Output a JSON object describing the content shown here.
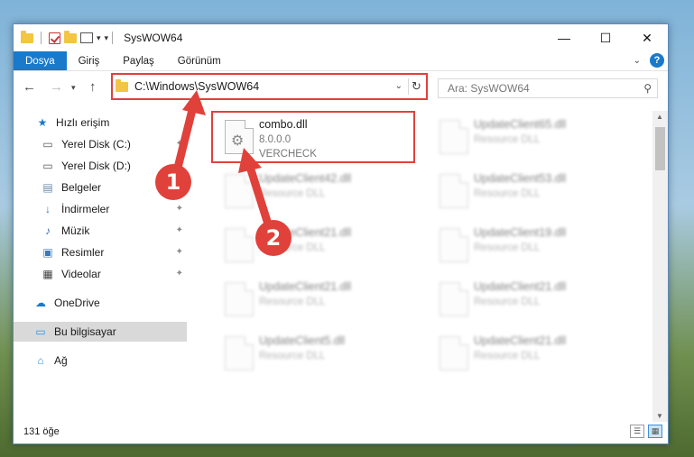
{
  "window": {
    "title": "SysWOW64",
    "controls": {
      "minimize": "—",
      "maximize": "☐",
      "close": "✕"
    }
  },
  "ribbon": {
    "tabs": [
      "Dosya",
      "Giriş",
      "Paylaş",
      "Görünüm"
    ],
    "help": "?"
  },
  "address": {
    "path": "C:\\Windows\\SysWOW64"
  },
  "search": {
    "placeholder": "Ara: SysWOW64"
  },
  "sidebar": {
    "items": [
      {
        "label": "Hızlı erişim",
        "icon": "star-icon"
      },
      {
        "label": "Yerel Disk (C:)",
        "icon": "drive-icon"
      },
      {
        "label": "Yerel Disk (D:)",
        "icon": "drive-icon"
      },
      {
        "label": "Belgeler",
        "icon": "documents-icon"
      },
      {
        "label": "İndirmeler",
        "icon": "download-icon"
      },
      {
        "label": "Müzik",
        "icon": "music-icon"
      },
      {
        "label": "Resimler",
        "icon": "pictures-icon"
      },
      {
        "label": "Videolar",
        "icon": "videos-icon"
      },
      {
        "label": "OneDrive",
        "icon": "cloud-icon"
      },
      {
        "label": "Bu bilgisayar",
        "icon": "computer-icon"
      },
      {
        "label": "Ağ",
        "icon": "network-icon"
      }
    ]
  },
  "files": {
    "highlighted": {
      "name": "combo.dll",
      "version": "8.0.0.0",
      "company": "VERCHECK"
    },
    "others": [
      {
        "name": "UpdateClient65.dll",
        "desc": "Resource DLL"
      },
      {
        "name": "UpdateClient42.dll",
        "desc": "Resource DLL"
      },
      {
        "name": "UpdateClient53.dll",
        "desc": "Resource DLL"
      },
      {
        "name": "UpdateClient21.dll",
        "desc": "Resource DLL"
      },
      {
        "name": "UpdateClient19.dll",
        "desc": "Resource DLL"
      },
      {
        "name": "UpdateClient21.dll",
        "desc": "Resource DLL"
      },
      {
        "name": "UpdateClient21.dll",
        "desc": "Resource DLL"
      },
      {
        "name": "UpdateClient5.dll",
        "desc": "Resource DLL"
      },
      {
        "name": "UpdateClient21.dll",
        "desc": "Resource DLL"
      }
    ]
  },
  "status": {
    "count": "131 öğe"
  },
  "annotations": {
    "badge1": "1",
    "badge2": "2",
    "color": "#e0413a"
  }
}
